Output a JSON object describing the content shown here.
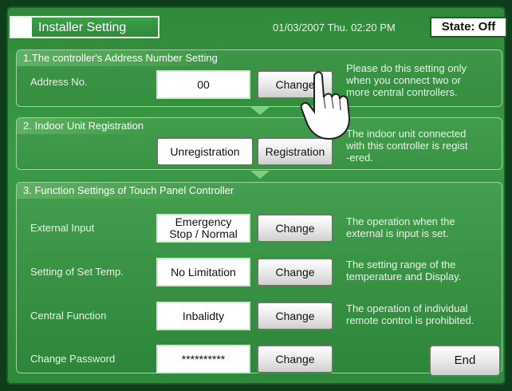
{
  "header": {
    "title": "Installer Setting",
    "datetime": "01/03/2007 Thu. 02:20 PM",
    "state": "State: Off"
  },
  "section1": {
    "title": "1.The controller's Address Number Setting",
    "address_label": "Address No.",
    "address_value": "00",
    "change_label": "Change",
    "note_lines": [
      "Please do this setting only",
      "when you connect two or",
      "more central controllers."
    ]
  },
  "section2": {
    "title": "2. Indoor Unit Registration",
    "unregistration_label": "Unregistration",
    "registration_label": "Registration",
    "note_lines": [
      "The indoor unit connected",
      "with this controller is regist",
      "-ered."
    ]
  },
  "section3": {
    "title": "3. Function Settings of Touch Panel Controller",
    "rows": [
      {
        "label": "External Input",
        "value_line1": "Emergency",
        "value_line2": "Stop / Normal",
        "change_label": "Change",
        "note_lines": [
          "The operation when the",
          "external is input is set."
        ]
      },
      {
        "label": "Setting of Set Temp.",
        "value": "No Limitation",
        "change_label": "Change",
        "note_lines": [
          "The setting range of the",
          "temperature and Display."
        ]
      },
      {
        "label": "Central Function",
        "value": "Inbalidty",
        "change_label": "Change",
        "note_lines": [
          "The operation of individual",
          "remote control is prohibited."
        ]
      },
      {
        "label": "Change Password",
        "value": "**********",
        "change_label": "Change"
      }
    ]
  },
  "footer": {
    "end_label": "End"
  },
  "icons": {
    "pointer": "pointing-hand-icon"
  }
}
